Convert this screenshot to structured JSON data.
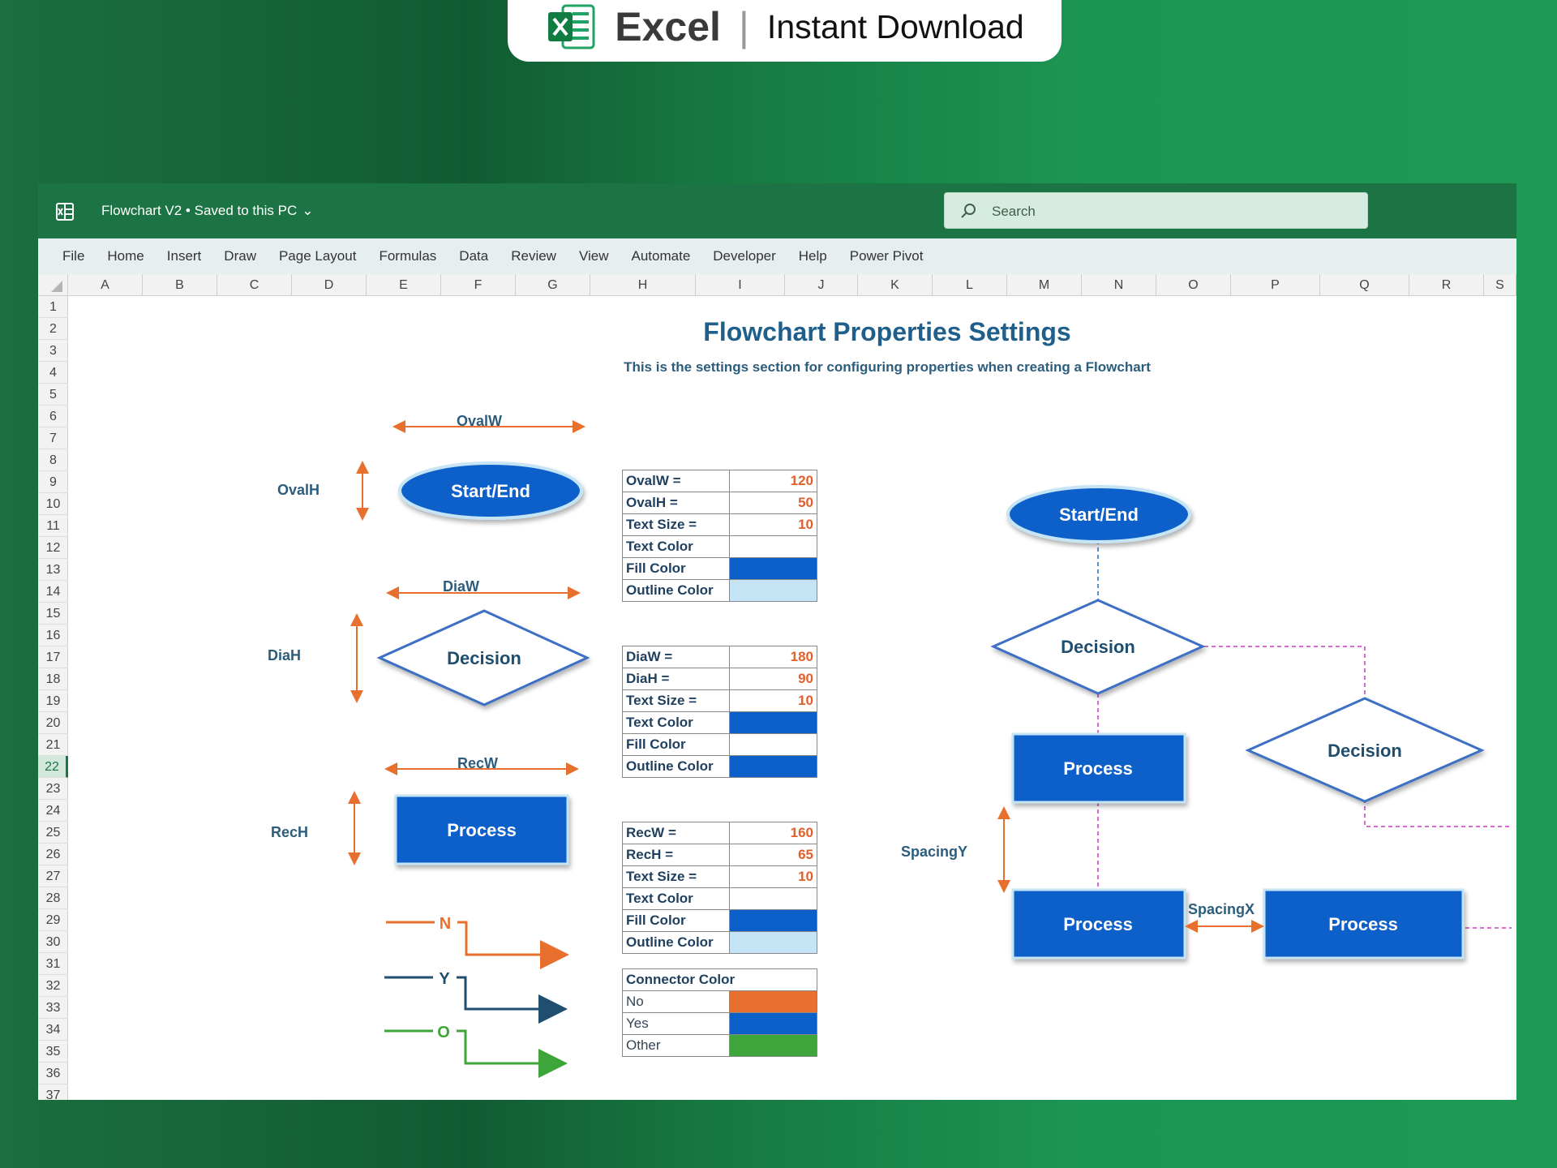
{
  "banner": {
    "brand": "Excel",
    "separator": "|",
    "tagline": "Instant Download"
  },
  "titlebar": {
    "doc_title": "Flowchart V2 • Saved to this PC",
    "search_placeholder": "Search"
  },
  "menu": [
    "File",
    "Home",
    "Insert",
    "Draw",
    "Page Layout",
    "Formulas",
    "Data",
    "Review",
    "View",
    "Automate",
    "Developer",
    "Help",
    "Power Pivot"
  ],
  "columns": [
    "A",
    "B",
    "C",
    "D",
    "E",
    "F",
    "G",
    "H",
    "I",
    "J",
    "K",
    "L",
    "M",
    "N",
    "O",
    "P",
    "Q",
    "R",
    "S"
  ],
  "rows": [
    "1",
    "2",
    "3",
    "4",
    "5",
    "6",
    "7",
    "8",
    "9",
    "10",
    "11",
    "12",
    "13",
    "14",
    "15",
    "16",
    "17",
    "18",
    "19",
    "20",
    "21",
    "22",
    "23",
    "24",
    "25",
    "26",
    "27",
    "28",
    "29",
    "30",
    "31",
    "32",
    "33",
    "34",
    "35",
    "36",
    "37"
  ],
  "selected_row": "22",
  "sheet": {
    "title": "Flowchart Properties Settings",
    "subtitle": "This is the settings section for configuring properties when creating a Flowchart",
    "oval": {
      "w_label": "OvalW",
      "h_label": "OvalH",
      "shape_text": "Start/End"
    },
    "diamond": {
      "w_label": "DiaW",
      "h_label": "DiaH",
      "shape_text": "Decision"
    },
    "rect": {
      "w_label": "RecW",
      "h_label": "RecH",
      "shape_text": "Process"
    },
    "connectors": {
      "n": "N",
      "y": "Y",
      "o": "O"
    },
    "oval_props": [
      {
        "label": "OvalW =",
        "value": "120"
      },
      {
        "label": "OvalH =",
        "value": "50"
      },
      {
        "label": "Text Size =",
        "value": "10"
      },
      {
        "label": "Text Color",
        "value": ""
      },
      {
        "label": "Fill Color",
        "value": ""
      },
      {
        "label": "Outline Color",
        "value": ""
      }
    ],
    "dia_props": [
      {
        "label": "DiaW =",
        "value": "180"
      },
      {
        "label": "DiaH =",
        "value": "90"
      },
      {
        "label": "Text Size =",
        "value": "10"
      },
      {
        "label": "Text Color",
        "value": ""
      },
      {
        "label": "Fill Color",
        "value": ""
      },
      {
        "label": "Outline Color",
        "value": ""
      }
    ],
    "rec_props": [
      {
        "label": "RecW =",
        "value": "160"
      },
      {
        "label": "RecH =",
        "value": "65"
      },
      {
        "label": "Text Size =",
        "value": "10"
      },
      {
        "label": "Text Color",
        "value": ""
      },
      {
        "label": "Fill Color",
        "value": ""
      },
      {
        "label": "Outline Color",
        "value": ""
      }
    ],
    "connector_props": {
      "header": "Connector Color",
      "rows": [
        {
          "label": "No",
          "color": "#e8702e"
        },
        {
          "label": "Yes",
          "color": "#0b5fc9"
        },
        {
          "label": "Other",
          "color": "#3ea53b"
        }
      ]
    },
    "flow": {
      "start": "Start/End",
      "decision1": "Decision",
      "decision2": "Decision",
      "process1": "Process",
      "process2": "Process",
      "process3": "Process",
      "spacing_y": "SpacingY",
      "spacing_x": "SpacingX"
    }
  },
  "colors": {
    "excel_green": "#1c7343",
    "shape_blue": "#0b5fc9",
    "light_blue": "#c5e4f5",
    "arrow_orange": "#e8702e",
    "arrow_navy": "#1f4e6e",
    "arrow_green": "#3ea53b",
    "dash_blue": "#5b8fd6",
    "dash_pink": "#d86bd0"
  }
}
